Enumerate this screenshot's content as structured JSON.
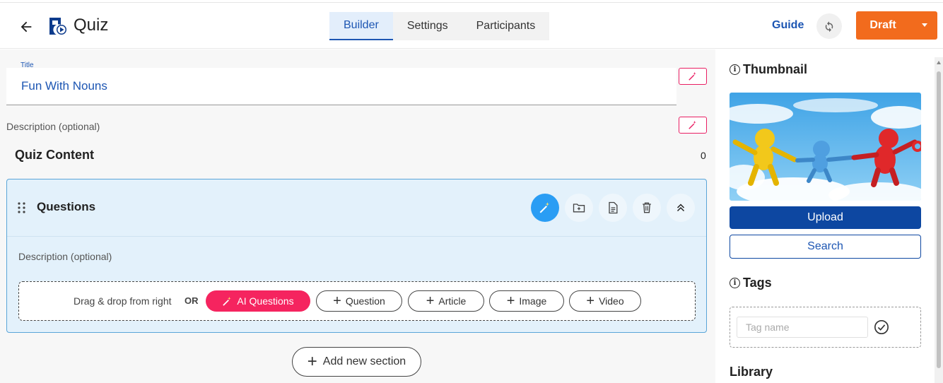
{
  "header": {
    "app_title": "Quiz",
    "tabs": [
      {
        "label": "Builder",
        "active": true
      },
      {
        "label": "Settings",
        "active": false
      },
      {
        "label": "Participants",
        "active": false
      }
    ],
    "guide_label": "Guide",
    "draft_label": "Draft"
  },
  "main": {
    "title_label": "Title",
    "title_value": "Fun With Nouns",
    "description_placeholder": "Description (optional)",
    "content_title": "Quiz Content",
    "content_count": "0",
    "section": {
      "title": "Questions",
      "description_placeholder": "Description (optional)",
      "drop_text": "Drag & drop from right",
      "or_text": "OR",
      "ai_questions_label": "AI Questions",
      "question_label": "Question",
      "article_label": "Article",
      "image_label": "Image",
      "video_label": "Video"
    },
    "add_section_label": "Add new section"
  },
  "right_panel": {
    "thumbnail_heading": "Thumbnail",
    "upload_label": "Upload",
    "search_label": "Search",
    "tags_heading": "Tags",
    "tag_placeholder": "Tag name",
    "library_heading": "Library"
  },
  "colors": {
    "accent_blue": "#1d56b3",
    "draft_orange": "#f26b1d",
    "ai_pink": "#f5245f",
    "section_bg": "#e3f1fb",
    "upload_blue": "#0d47a1"
  }
}
